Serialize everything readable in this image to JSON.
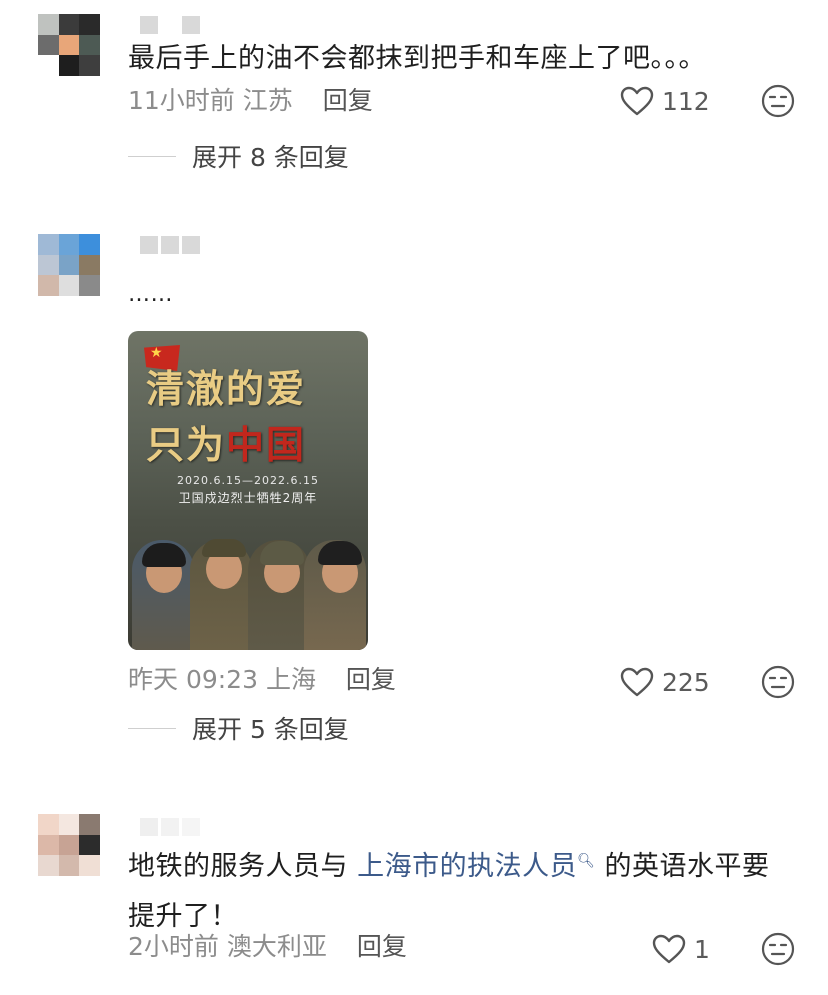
{
  "comments": [
    {
      "text": "最后手上的油不会都抹到把手和车座上了吧。。。",
      "time": "11小时前",
      "location": "江苏",
      "reply_label": "回复",
      "likes": "112",
      "expand_label": "展开 8 条回复"
    },
    {
      "text": "……",
      "poster": {
        "title_line1": "清澈的爱",
        "title_line2_a": "只为",
        "title_line2_b": "中国",
        "date": "2020.6.15—2022.6.15",
        "subtitle": "卫国戍边烈士牺牲2周年"
      },
      "time": "昨天 09:23",
      "location": "上海",
      "reply_label": "回复",
      "likes": "225",
      "expand_label": "展开 5 条回复"
    },
    {
      "text_before": "地铁的服务人员与 ",
      "link_text": "上海市的执法人员",
      "text_after": " 的英语水平要提升了！",
      "time": "2小时前",
      "location": "澳大利亚",
      "reply_label": "回复",
      "likes": "1"
    }
  ],
  "icons": {
    "like": "heart-outline-icon",
    "reaction": "expressionless-face-icon",
    "link_search": "search-icon"
  },
  "colors": {
    "link": "#3c5a8a",
    "meta": "#8c8c8c"
  }
}
